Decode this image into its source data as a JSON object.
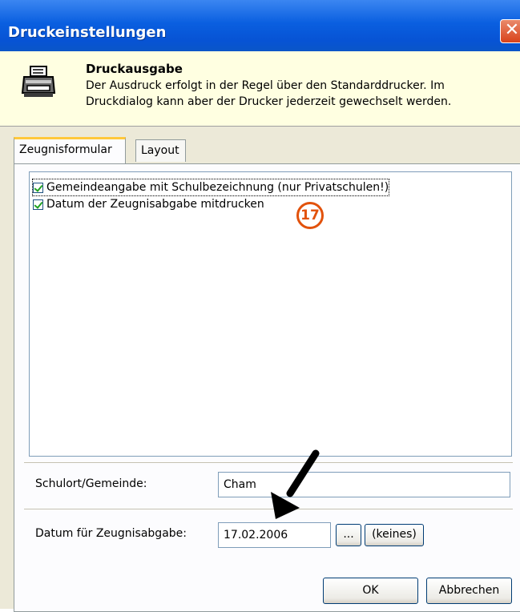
{
  "window": {
    "title": "Druckeinstellungen",
    "close_glyph": "✕"
  },
  "header": {
    "title": "Druckausgabe",
    "text": "Der Ausdruck erfolgt in der Regel über den Standarddrucker. Im Druckdialog kann aber der Drucker jederzeit gewechselt werden.",
    "icon": "printer-icon"
  },
  "tabs": [
    {
      "label": "Zeugnisformular",
      "active": true
    },
    {
      "label": "Layout",
      "active": false
    }
  ],
  "options": [
    {
      "label": "Gemeindeangabe mit Schulbezeichnung (nur Privatschulen!)",
      "checked": true
    },
    {
      "label": "Datum der Zeugnisabgabe mitdrucken",
      "checked": true
    }
  ],
  "annotation": {
    "badge": "17",
    "arrow_icon": "arrow-down-icon"
  },
  "fields": {
    "schulort_label": "Schulort/Gemeinde:",
    "schulort_value": "Cham",
    "datum_label": "Datum für Zeugnisabgabe:",
    "datum_value": "17.02.2006",
    "browse_label": "...",
    "keines_label": "(keines)"
  },
  "buttons": {
    "ok": "OK",
    "cancel": "Abbrechen"
  }
}
